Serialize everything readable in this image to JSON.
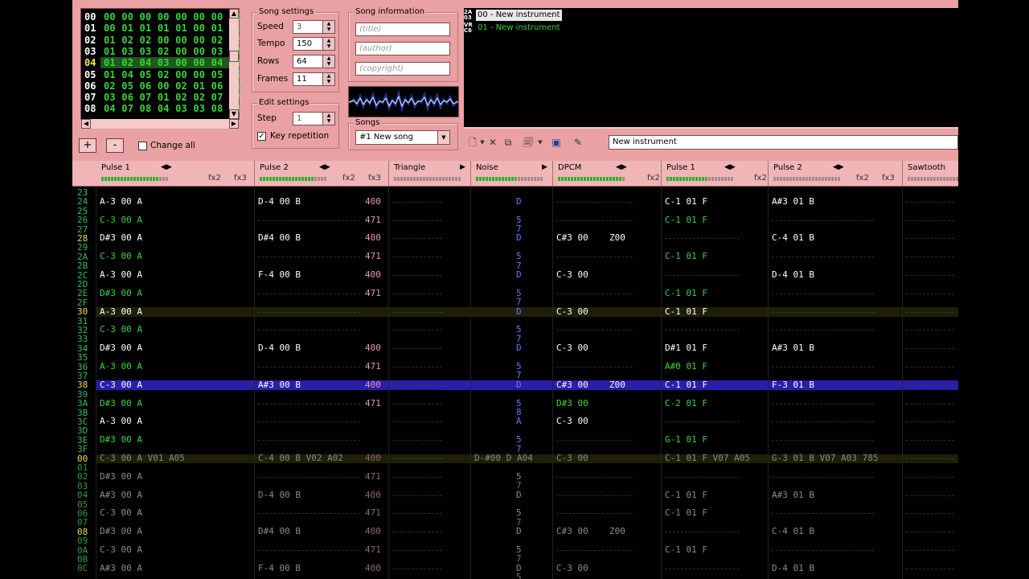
{
  "colors": {
    "panel_pink": "#e9a1a3",
    "frame_value_green": "#37d437",
    "row_number_green": "#2dbb6e",
    "row_number_highlight": "#e6e23a",
    "note_white": "#ffffff",
    "note_green": "#3bd43b",
    "instrument_blue": "#6a78ff",
    "effect_pink": "#e99ba6",
    "cursor_row": "#2a1eaa",
    "highlight_row": "#1f1f08"
  },
  "frames": {
    "rows": [
      {
        "num": "00",
        "values": "00 00 00 00 00 00 00 00",
        "selected": false
      },
      {
        "num": "01",
        "values": "00 01 01 01 01 00 01 01",
        "selected": false
      },
      {
        "num": "02",
        "values": "01 02 02 00 00 00 02 02",
        "selected": false
      },
      {
        "num": "03",
        "values": "01 03 03 02 00 00 03 03",
        "selected": false
      },
      {
        "num": "04",
        "values": "01 02 04 03 00 00 04 04",
        "selected": true
      },
      {
        "num": "05",
        "values": "01 04 05 02 00 00 05 05",
        "selected": false
      },
      {
        "num": "06",
        "values": "02 05 06 00 02 01 06 06",
        "selected": false
      },
      {
        "num": "07",
        "values": "03 06 07 01 02 02 07 07",
        "selected": false
      },
      {
        "num": "08",
        "values": "04 07 08 04 03 03 08 08",
        "selected": false
      }
    ],
    "add_label": "+",
    "remove_label": "-",
    "change_all_label": "Change all"
  },
  "song_settings": {
    "title": "Song settings",
    "speed_label": "Speed",
    "speed": "3",
    "tempo_label": "Tempo",
    "tempo": "150",
    "rows_label": "Rows",
    "rows": "64",
    "frames_label": "Frames",
    "frames": "11"
  },
  "edit_settings": {
    "title": "Edit settings",
    "step_label": "Step",
    "step": "1",
    "key_repetition_label": "Key repetition",
    "key_repetition_checked": true
  },
  "song_information": {
    "title": "Song information",
    "title_placeholder": "(title)",
    "author_placeholder": "(author)",
    "copyright_placeholder": "(copyright)"
  },
  "songs": {
    "title": "Songs",
    "selected": "#1 New song"
  },
  "instruments": [
    {
      "icon": "2A03",
      "name": "00 - New instrument",
      "selected": true,
      "color": "#ffffff"
    },
    {
      "icon": "VRC6",
      "name": "01 - New instrument",
      "selected": false,
      "color": "#37d437"
    }
  ],
  "instrument_name": "New instrument",
  "toolbar_icons": [
    "new-instrument-icon",
    "dropdown-arrow-icon",
    "remove-instrument-icon",
    "clone-instrument-icon",
    "load-instrument-icon",
    "dropdown-arrow-icon",
    "save-instrument-icon",
    "edit-instrument-icon"
  ],
  "channels": [
    {
      "name": "Pulse 1",
      "fx2": "fx2",
      "fx3": "fx3",
      "level": 0.85,
      "width": 197
    },
    {
      "name": "Pulse 2",
      "fx2": "fx2",
      "fx3": "fx3",
      "level": 0.8,
      "width": 167
    },
    {
      "name": "Triangle",
      "fx2": "",
      "fx3": "",
      "level": 0,
      "width": 102
    },
    {
      "name": "Noise",
      "fx2": "",
      "fx3": "",
      "level": 0.6,
      "width": 102
    },
    {
      "name": "DPCM",
      "fx2": "fx2",
      "fx3": "",
      "level": 0.95,
      "width": 135
    },
    {
      "name": "Pulse 1",
      "fx2": "fx2",
      "fx3": "",
      "level": 0.6,
      "width": 133
    },
    {
      "name": "Pulse 2",
      "fx2": "fx2",
      "fx3": "fx3",
      "level": 0,
      "width": 167
    },
    {
      "name": "Sawtooth",
      "fx2": "",
      "fx3": "",
      "level": 0,
      "width": 100
    }
  ],
  "row_numbers": [
    "23",
    "24",
    "25",
    "26",
    "27",
    "28",
    "29",
    "2A",
    "2B",
    "2C",
    "2D",
    "2E",
    "2F",
    "30",
    "31",
    "32",
    "33",
    "34",
    "35",
    "36",
    "37",
    "38",
    "39",
    "3A",
    "3B",
    "3C",
    "3D",
    "3E",
    "3F",
    "00",
    "01",
    "02",
    "03",
    "04",
    "05",
    "06",
    "07",
    "08",
    "09",
    "0A",
    "0B",
    "0C"
  ],
  "cursor_row_index": 15,
  "pattern_rows": [
    {
      "cells": [
        "A-3 00 A",
        "D-4 00 B",
        "",
        "D",
        "",
        "C-1 01 F",
        "A#3 01 B",
        ""
      ],
      "fx": [
        "",
        "400",
        "",
        "",
        "",
        "",
        "",
        ""
      ]
    },
    {
      "cells": [
        "C-3 00 A",
        "",
        "",
        "5",
        "",
        "C-1 01 F",
        "",
        ""
      ],
      "fx": [
        "",
        "471",
        "",
        "7",
        "",
        "",
        "",
        ""
      ]
    },
    {
      "cells": [
        "D#3 00 A",
        "D#4 00 B",
        "",
        "D",
        "C#3 00",
        "",
        "C-4 01 B",
        ""
      ],
      "fx": [
        "",
        "400",
        "",
        "",
        "Z00",
        "",
        "",
        ""
      ]
    },
    {
      "cells": [
        "C-3 00 A",
        "",
        "",
        "5",
        "",
        "C-1 01 F",
        "",
        ""
      ],
      "fx": [
        "",
        "471",
        "",
        "7",
        "",
        "",
        "",
        ""
      ]
    },
    {
      "cells": [
        "A-3 00 A",
        "F-4 00 B",
        "",
        "D",
        "C-3 00",
        "",
        "D-4 01 B",
        ""
      ],
      "fx": [
        "",
        "400",
        "",
        "",
        "",
        "",
        "",
        ""
      ]
    },
    {
      "cells": [
        "D#3 00 A",
        "",
        "",
        "5",
        "",
        "C-1 01 F",
        "",
        ""
      ],
      "fx": [
        "",
        "471",
        "",
        "7",
        "",
        "",
        "",
        ""
      ]
    },
    {
      "cells": [
        "A-3 00 A",
        "",
        "",
        "D",
        "C-3 00",
        "C-1 01 F",
        "",
        ""
      ],
      "fx": [
        "",
        "",
        "",
        "",
        "",
        "",
        "",
        ""
      ]
    },
    {
      "cells": [
        "C-3 00 A",
        "",
        "",
        "5",
        "",
        "",
        "",
        ""
      ],
      "fx": [
        "",
        "",
        "",
        "7",
        "",
        "",
        "",
        ""
      ]
    },
    {
      "cells": [
        "D#3 00 A",
        "D-4 00 B",
        "",
        "D",
        "C-3 00",
        "D#1 01 F",
        "A#3 01 B",
        ""
      ],
      "fx": [
        "",
        "400",
        "",
        "",
        "",
        "",
        "",
        ""
      ]
    },
    {
      "cells": [
        "A-3 00 A",
        "",
        "",
        "5",
        "",
        "A#0 01 F",
        "",
        ""
      ],
      "fx": [
        "",
        "471",
        "",
        "7",
        "",
        "",
        "",
        ""
      ]
    },
    {
      "cells": [
        "C-3 00 A",
        "A#3 00 B",
        "",
        "D",
        "C#3 00",
        "C-1 01 F",
        "F-3 01 B",
        ""
      ],
      "fx": [
        "",
        "400",
        "",
        "",
        "Z00",
        "",
        "",
        ""
      ]
    },
    {
      "cells": [
        "D#3 00 A",
        "",
        "",
        "5",
        "D#3 00",
        "C-2 01 F",
        "",
        ""
      ],
      "fx": [
        "",
        "471",
        "",
        "8",
        "",
        "",
        "",
        ""
      ]
    },
    {
      "cells": [
        "A-3 00 A",
        "",
        "",
        "A",
        "C-3 00",
        "",
        "",
        ""
      ],
      "fx": [
        "",
        "",
        "",
        "",
        "",
        "",
        "",
        ""
      ]
    },
    {
      "cells": [
        "D#3 00 A",
        "",
        "",
        "5",
        "",
        "G-1 01 F",
        "",
        ""
      ],
      "fx": [
        "",
        "",
        "",
        "7",
        "",
        "",
        "",
        ""
      ]
    },
    {
      "cells": [
        "C-3 00 A V01 A05",
        "C-4 00 B V02 A02",
        "",
        "D-#00 D A04",
        "C-3 00",
        "C-1 01 F V07 A05",
        "G-3 01 B V07 A03 785",
        ""
      ],
      "fx": [
        "",
        "400",
        "",
        "",
        "",
        "",
        "",
        ""
      ]
    },
    {
      "cells": [
        "D#3 00 A",
        "",
        "",
        "5",
        "",
        "",
        "",
        ""
      ],
      "fx": [
        "",
        "471",
        "",
        "7",
        "",
        "",
        "",
        ""
      ]
    },
    {
      "cells": [
        "A#3 00 A",
        "D-4 00 B",
        "",
        "D",
        "",
        "C-1 01 F",
        "A#3 01 B",
        ""
      ],
      "fx": [
        "",
        "400",
        "",
        "",
        "",
        "",
        "",
        ""
      ]
    },
    {
      "cells": [
        "C-3 00 A",
        "",
        "",
        "5",
        "",
        "C-1 01 F",
        "",
        ""
      ],
      "fx": [
        "",
        "471",
        "",
        "7",
        "",
        "",
        "",
        ""
      ]
    },
    {
      "cells": [
        "D#3 00 A",
        "D#4 00 B",
        "",
        "D",
        "C#3 00",
        "",
        "C-4 01 B",
        ""
      ],
      "fx": [
        "",
        "400",
        "",
        "",
        "Z00",
        "",
        "",
        ""
      ]
    },
    {
      "cells": [
        "C-3 00 A",
        "",
        "",
        "5",
        "",
        "C-1 01 F",
        "",
        ""
      ],
      "fx": [
        "",
        "471",
        "",
        "7",
        "",
        "",
        "",
        ""
      ]
    },
    {
      "cells": [
        "A#3 00 A",
        "F-4 00 B",
        "",
        "D",
        "C-3 00",
        "",
        "D-4 01 B",
        ""
      ],
      "fx": [
        "",
        "400",
        "",
        "5",
        "",
        "",
        "",
        ""
      ]
    }
  ]
}
